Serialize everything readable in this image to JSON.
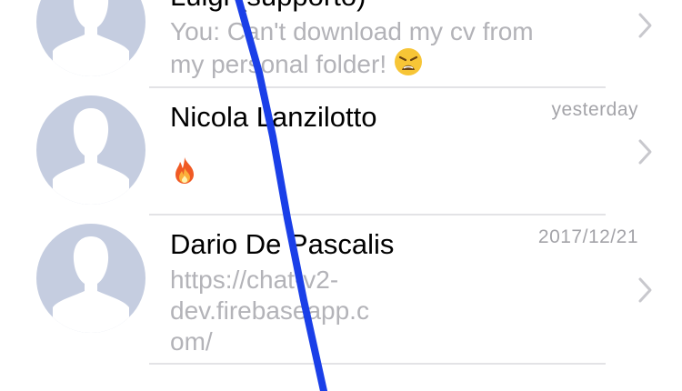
{
  "conversations": [
    {
      "title": "Luigi (supporto)",
      "preview": "You: Can't download my cv from my personal folder!",
      "emoji": "weary-face",
      "date": ""
    },
    {
      "title": "Nicola Lanzilotto",
      "preview": "",
      "emoji": "fire",
      "date": "yesterday"
    },
    {
      "title": "Dario De Pascalis",
      "preview": "https://chat-v2-dev.firebaseapp.com/",
      "emoji": "",
      "date": "2017/12/21"
    }
  ],
  "icons": {
    "avatar": "default-person-silhouette",
    "chevron": "chevron-right-icon"
  },
  "colors": {
    "avatar": "#c5cde0",
    "preview_text": "#b3b3b8",
    "date_text": "#a4a4a9",
    "chevron": "#c8c8cd",
    "divider": "#e3e3e6",
    "annotation_stroke": "#1a3fe8"
  }
}
